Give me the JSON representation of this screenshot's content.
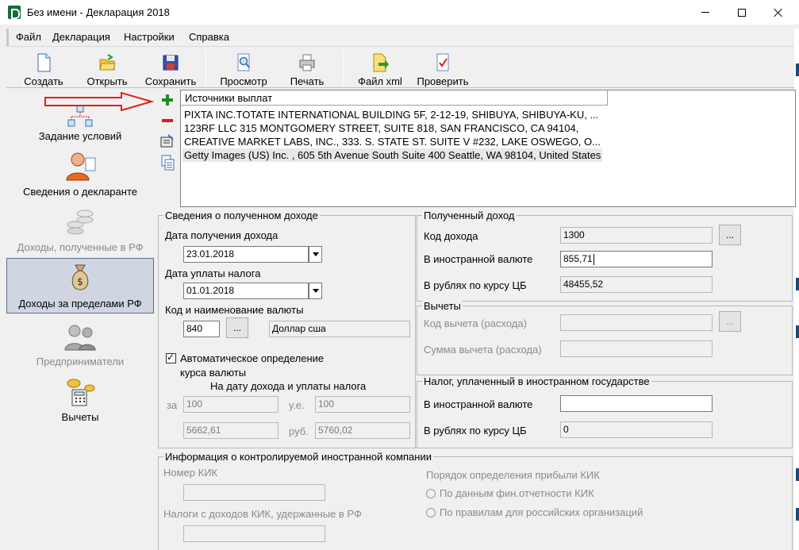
{
  "window": {
    "title": "Без имени - Декларация 2018"
  },
  "menu": [
    "Файл",
    "Декларация",
    "Настройки",
    "Справка"
  ],
  "toolbar": {
    "create": "Создать",
    "open": "Открыть",
    "save": "Сохранить",
    "preview": "Просмотр",
    "print": "Печать",
    "xml": "Файл xml",
    "check": "Проверить"
  },
  "nav": {
    "conditions": "Задание условий",
    "declarant": "Сведения о декларанте",
    "income_rf": "Доходы, полученные в РФ",
    "income_abroad": "Доходы за пределами РФ",
    "entrepreneurs": "Предприниматели",
    "deductions": "Вычеты"
  },
  "sources": {
    "header": "Источники выплат",
    "rows": [
      "PIXTA INC.TOTATE INTERNATIONAL BUILDING 5F, 2-12-19, SHIBUYA, SHIBUYA-KU, ...",
      "123RF LLC 315 MONTGOMERY STREET, SUITE 818, SAN FRANCISCO, CA 94104,",
      "CREATIVE MARKET LABS, INC., 333. S. STATE ST. SUITE V #232, LAKE OSWEGO, O...",
      "Getty Images (US) Inc. , 605 5th Avenue South Suite 400 Seattle, WA 98104, United States"
    ]
  },
  "income_info": {
    "title": "Сведения о полученном доходе",
    "date_received_label": "Дата получения дохода",
    "date_received": "23.01.2018",
    "date_tax_label": "Дата уплаты налога",
    "date_tax": "01.01.2018",
    "currency_label": "Код и наименование валюты",
    "currency_code": "840",
    "currency_name": "Доллар сша",
    "dots": "...",
    "auto_rate_line1": "Автоматическое определение",
    "auto_rate_line2": "курса валюты",
    "rate_caption": "На дату дохода и уплаты налога",
    "per_label": "за",
    "units_label": "у.е.",
    "rub_label": "руб.",
    "per_income": "100",
    "per_tax": "100",
    "rub_income": "5662,61",
    "rub_tax": "5760,02"
  },
  "received_income": {
    "title": "Полученный доход",
    "code_label": "Код дохода",
    "code": "1300",
    "foreign_label": "В иностранной валюте",
    "foreign": "855,71",
    "rub_label": "В рублях по курсу ЦБ",
    "rub": "48455,52"
  },
  "deductions": {
    "title": "Вычеты",
    "code_label": "Код вычета (расхода)",
    "sum_label": "Сумма вычета (расхода)"
  },
  "tax_paid": {
    "title": "Налог, уплаченный в иностранном государстве",
    "foreign_label": "В иностранной валюте",
    "foreign": "",
    "rub_label": "В рублях по курсу ЦБ",
    "rub": "0"
  },
  "kik": {
    "title": "Информация о контролируемой иностранной компании",
    "number_label": "Номер КИК",
    "taxes_label": "Налоги с доходов КИК, удержанные в РФ",
    "profit_label": "Порядок определения прибыли КИК",
    "option1": "По данным фин.отчетности КИК",
    "option2": "По правилам для российских организаций"
  },
  "colors": {
    "arrow": "#e0201a",
    "plus": "#1f8c1f",
    "minus": "#d42020",
    "nav_selected": "#cfd6e2"
  },
  "icons": [
    "document-new-icon",
    "folder-open-icon",
    "floppy-save-icon",
    "magnifier-preview-icon",
    "printer-icon",
    "xml-export-icon",
    "check-document-icon"
  ]
}
